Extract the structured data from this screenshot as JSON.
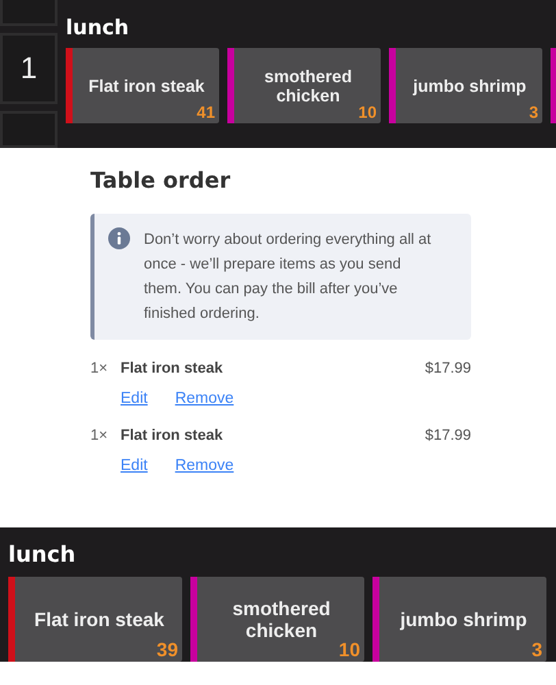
{
  "top_panel": {
    "seat": "1",
    "category": "lunch",
    "items": [
      {
        "name": "Flat iron steak",
        "count": "41",
        "color": "#d0101a"
      },
      {
        "name": "smothered chicken",
        "count": "10",
        "color": "#c8009e"
      },
      {
        "name": "jumbo shrimp",
        "count": "3",
        "color": "#c8009e"
      },
      {
        "color": "#c8009e"
      }
    ]
  },
  "order": {
    "title": "Table order",
    "notice": "Don’t worry about ordering everything all at once - we’ll prepare items as you send them. You can pay the bill after you’ve finished ordering.",
    "lines": [
      {
        "quantity": "1×",
        "name": "Flat iron steak",
        "price": "$17.99",
        "actions": [
          "Edit",
          "Remove"
        ]
      },
      {
        "quantity": "1×",
        "name": "Flat iron steak",
        "price": "$17.99",
        "actions": [
          "Edit",
          "Remove"
        ]
      }
    ]
  },
  "bottom_panel": {
    "category": "lunch",
    "items": [
      {
        "name": "Flat iron steak",
        "count": "39",
        "color": "#d0101a"
      },
      {
        "name": "smothered chicken",
        "count": "10",
        "color": "#c8009e"
      },
      {
        "name": "jumbo shrimp",
        "count": "3",
        "color": "#c8009e"
      }
    ]
  }
}
